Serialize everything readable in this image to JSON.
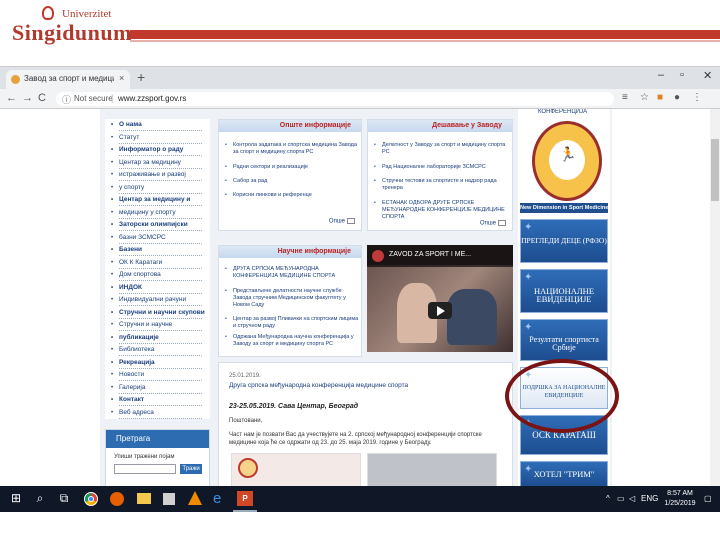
{
  "slide": {
    "logo_top": "Univerzitet",
    "logo_name": "Singidunum",
    "accent": "#c0392b"
  },
  "browser": {
    "tab_title": "Завод за спорт и медицину",
    "tab_close": "×",
    "new_tab": "+",
    "window": {
      "minimize": "–",
      "restore": "▫",
      "close": "✕"
    },
    "nav": {
      "back": "←",
      "forward": "→",
      "reload": "C"
    },
    "not_secure": "Not secure",
    "url": "www.zzsport.gov.rs",
    "toolbar_icons": [
      "menu-lines-icon",
      "star-icon",
      "extension-icon",
      "profile-icon",
      "more-icon"
    ]
  },
  "left_menu": {
    "items": [
      {
        "label": "О нама",
        "bold": true
      },
      {
        "label": "Статут",
        "bold": false
      },
      {
        "label": "Информатор о раду",
        "bold": true
      },
      {
        "label": "Центар за медицину",
        "bold": false
      },
      {
        "label": "истраживање и развој",
        "bold": false
      },
      {
        "label": "у спорту",
        "bold": false
      },
      {
        "label": "Центар за медицину и",
        "bold": true
      },
      {
        "label": "медицину у спорту",
        "bold": false
      },
      {
        "label": "Заторски олимпијски",
        "bold": true
      },
      {
        "label": "базни ЗСМСРС",
        "bold": false
      },
      {
        "label": "Базени",
        "bold": true
      },
      {
        "label": "ОК К Каратаги",
        "bold": false
      },
      {
        "label": "Дом спортова",
        "bold": false
      },
      {
        "label": "ИНДОК",
        "bold": true
      },
      {
        "label": "Индивидуални рачуни",
        "bold": false
      },
      {
        "label": "Стручни и научни скупови",
        "bold": true
      },
      {
        "label": "Стручни и научне",
        "bold": false
      },
      {
        "label": "публикације",
        "bold": true
      },
      {
        "label": "Библиотека",
        "bold": false
      },
      {
        "label": "Рекреација",
        "bold": true
      },
      {
        "label": "Новости",
        "bold": false
      },
      {
        "label": "Галерија",
        "bold": false
      },
      {
        "label": "Контакт",
        "bold": true
      },
      {
        "label": "Веб адреса",
        "bold": false
      }
    ],
    "search_title": "Претрага",
    "search_label": "Упиши тражени појам",
    "search_button": "Тражи"
  },
  "panels": {
    "general": {
      "title": "Опште информације",
      "items": [
        "Контрола задатака и спортска медицина Завода за спорт и медицину спорта РС",
        "Радни сектори и реализације",
        "Сабор за рад",
        "Корисни линкови и референце"
      ],
      "more": "Опше"
    },
    "news": {
      "title": "Дешавање у Заводу",
      "items": [
        "Делатност у Заводу за спорт и медицину спорта РС",
        "Рад Националне лабораторије ЗСМСРС",
        "Стручни тестови за спортисте и надзор рада тренера",
        "ЕСТАНАК ОДБОРА ДРУГЕ СРПСКЕ МЕЂУНАРОДНЕ КОНФЕРЕНЦИЈЕ МЕДИЦИНЕ СПОРТА"
      ],
      "more": "Опше"
    },
    "science": {
      "title": "Научне информације",
      "items": [
        "ДРУГА СРПСКА МЕЂУНАРОДНА КОНФЕРЕНЦИЈА МЕДИЦИНЕ СПОРТА",
        "Представљене делатности научне службе Завода стручним Медицинском факултету у Новом Саду",
        "Центар за развој Пливачки на спортским лицима и стручном раду",
        "Одржана Међународна научна конференција у Заводу за спорт и медицину спорта РС"
      ],
      "more": "Опше"
    }
  },
  "video": {
    "title": "ZAVOD ZA SPORT I ME..."
  },
  "article": {
    "date": "25.01.2019.",
    "headline": "Друга српска међународна конференција медицине спорта",
    "subheadline": "23-25.05.2019. Сава Центар, Београд",
    "p1": "Поштовани,",
    "p2": "Част нам је позвати Вас да учествујете на 2. српској међународној конференцији спортске медицине која ће се одржати од 23. до 25. маја 2019. године у Београду."
  },
  "right_col": {
    "conference_label": "КОНФЕРЕНЦИЈА",
    "conference_caption": "New Dimension in Sport Medicine",
    "buttons": [
      {
        "label": "ПРЕГЛЕДИ ДЕЦЕ (РФЗО)",
        "size": 7.5,
        "light": false
      },
      {
        "label": "НАЦИОНАЛНЕ ЕВИДЕНЦИЈЕ",
        "size": 8.5,
        "light": false
      },
      {
        "label": "Резултати спортиста Србије",
        "size": 8,
        "light": false
      },
      {
        "label": "ПОДРШКА ЗА НАЦИОНАЛНЕ ЕВИДЕНЦИЈЕ",
        "size": 6,
        "light": true
      },
      {
        "label": "ОСК КАРАТАШ",
        "size": 9,
        "light": false
      },
      {
        "label": "ХОТЕЛ \"ТРИМ\"",
        "size": 8.5,
        "light": false
      }
    ],
    "highlight_color": "#7a1414"
  },
  "taskbar": {
    "start": "⊞",
    "search": "⌕",
    "taskview": "⧉",
    "tray_up": "^",
    "lang": "ENG",
    "time": "8:57 AM",
    "date": "1/25/2019"
  }
}
